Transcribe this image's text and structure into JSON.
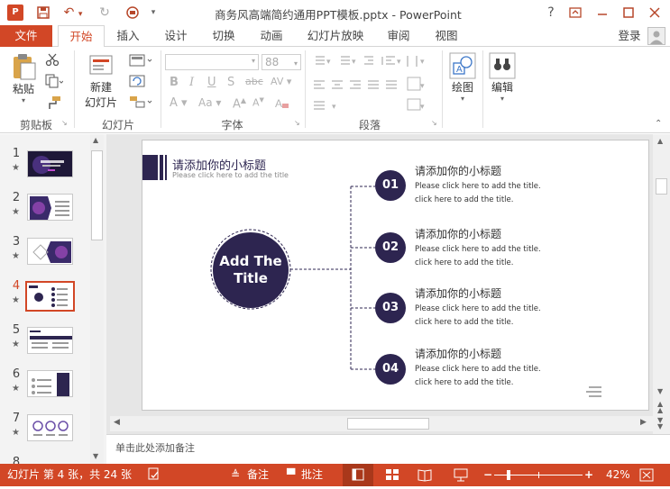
{
  "app": {
    "title": "商务风高端简约通用PPT模板.pptx - PowerPoint",
    "logo": "P",
    "help": "?",
    "signin": "登录"
  },
  "tabs": [
    "文件",
    "开始",
    "插入",
    "设计",
    "切换",
    "动画",
    "幻灯片放映",
    "审阅",
    "视图"
  ],
  "ribbon": {
    "paste": "粘贴",
    "new_slide_line1": "新建",
    "new_slide_line2": "幻灯片",
    "font_size": "88",
    "draw": "绘图",
    "edit": "编辑",
    "groups": {
      "clipboard": "剪贴板",
      "slides": "幻灯片",
      "font": "字体",
      "paragraph": "段落"
    }
  },
  "thumbnails": [
    {
      "num": "1",
      "star": "★"
    },
    {
      "num": "2",
      "star": "★"
    },
    {
      "num": "3",
      "star": "★"
    },
    {
      "num": "4",
      "star": "★"
    },
    {
      "num": "5",
      "star": "★"
    },
    {
      "num": "6",
      "star": "★"
    },
    {
      "num": "7",
      "star": "★"
    },
    {
      "num": "8",
      "star": ""
    }
  ],
  "slide": {
    "header_title": "请添加你的小标题",
    "header_sub": "Please click here to add the title",
    "center_line1": "Add The",
    "center_line2": "Title",
    "items": [
      {
        "num": "01",
        "title": "请添加你的小标题",
        "line1": "Please click here to add the title.",
        "line2": "click here to add the title."
      },
      {
        "num": "02",
        "title": "请添加你的小标题",
        "line1": "Please click here to add the title.",
        "line2": "click here to add the title."
      },
      {
        "num": "03",
        "title": "请添加你的小标题",
        "line1": "Please click here to add the title.",
        "line2": "click here to add the title."
      },
      {
        "num": "04",
        "title": "请添加你的小标题",
        "line1": "Please click here to add the title.",
        "line2": "click here to add the title."
      }
    ],
    "accent_color": "#2d2550"
  },
  "notes_placeholder": "单击此处添加备注",
  "status": {
    "slide_info": "幻灯片 第 4 张，共 24 张",
    "notes": "备注",
    "comments": "批注",
    "zoom": "42%"
  },
  "colors": {
    "brand": "#d24726",
    "accent": "#2d2550"
  }
}
